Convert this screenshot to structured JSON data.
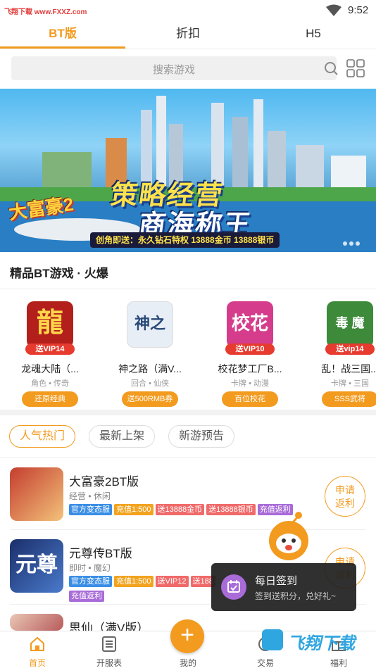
{
  "status_bar": {
    "watermark": "飞翔下载 www.FXXZ.com",
    "time": "9:52"
  },
  "tabs": [
    {
      "label": "BT版",
      "active": true
    },
    {
      "label": "折扣"
    },
    {
      "label": "H5"
    }
  ],
  "search": {
    "placeholder": "搜索游戏"
  },
  "banner": {
    "logo": "大富豪2",
    "slogan_line1": "策略经营",
    "slogan_line2": "商海称王",
    "strip": "创角即送：永久钻石特权 13888金币 13888银币",
    "dots": 3
  },
  "featured": {
    "title": "精品BT游戏 · 火爆",
    "games": [
      {
        "name": "龙魂大陆（...",
        "tags": "角色 • 传奇",
        "vip": "送VIP14",
        "button": "还原经典",
        "cover_char": "龍",
        "cover_color": "#b3201b"
      },
      {
        "name": "神之路（满V...",
        "tags": "回合 • 仙侠",
        "vip": "",
        "button": "送500RMB券",
        "cover_char": "神之路",
        "cover_color": "#e8eef5"
      },
      {
        "name": "校花梦工厂B...",
        "tags": "卡牌 • 动漫",
        "vip": "送VIP10",
        "button": "百位校花",
        "cover_char": "校花",
        "cover_color": "#d63c8c"
      },
      {
        "name": "乱！战三国...",
        "tags": "卡牌 • 三国",
        "vip": "送vip14",
        "button": "SSS武将",
        "cover_char": "毒 魔",
        "cover_color": "#3d8a3a"
      }
    ]
  },
  "filters": [
    {
      "label": "人气热门",
      "active": true
    },
    {
      "label": "最新上架"
    },
    {
      "label": "新游预告"
    }
  ],
  "list": [
    {
      "title": "大富豪2BT版",
      "sub": "经营 • 休闲",
      "tags": [
        {
          "text": "官方变态服",
          "color": "#3a8ee6"
        },
        {
          "text": "充值1:500",
          "color": "#f2a31f"
        },
        {
          "text": "送13888金币",
          "color": "#f06a6a"
        },
        {
          "text": "送13888银币",
          "color": "#f06a6a"
        },
        {
          "text": "充值返利",
          "color": "#a86bd8"
        }
      ],
      "apply": "申请返利"
    },
    {
      "title": "元尊传BT版",
      "sub": "即时 • 魔幻",
      "tags": [
        {
          "text": "官方变态服",
          "color": "#3a8ee6"
        },
        {
          "text": "充值1:500",
          "color": "#f2a31f"
        },
        {
          "text": "送VIP12",
          "color": "#f06a6a"
        },
        {
          "text": "送188",
          "color": "#f06a6a"
        },
        {
          "text": "充值返利",
          "color": "#a86bd8"
        }
      ],
      "apply": "申请返利"
    },
    {
      "title": "思仙（满V版）",
      "sub": "",
      "tags": [],
      "apply": ""
    }
  ],
  "popup": {
    "title": "每日签到",
    "subtitle": "签到送积分，兑好礼~"
  },
  "bottom_nav": [
    {
      "label": "首页",
      "icon": "home-icon",
      "active": true
    },
    {
      "label": "开服表",
      "icon": "list-icon"
    },
    {
      "label": "我的",
      "icon": "add-icon"
    },
    {
      "label": "交易",
      "icon": "trade-icon"
    },
    {
      "label": "福利",
      "icon": "gift-icon"
    }
  ],
  "bottom_watermark": "飞翔下载",
  "colors": {
    "accent": "#f29b1f"
  }
}
